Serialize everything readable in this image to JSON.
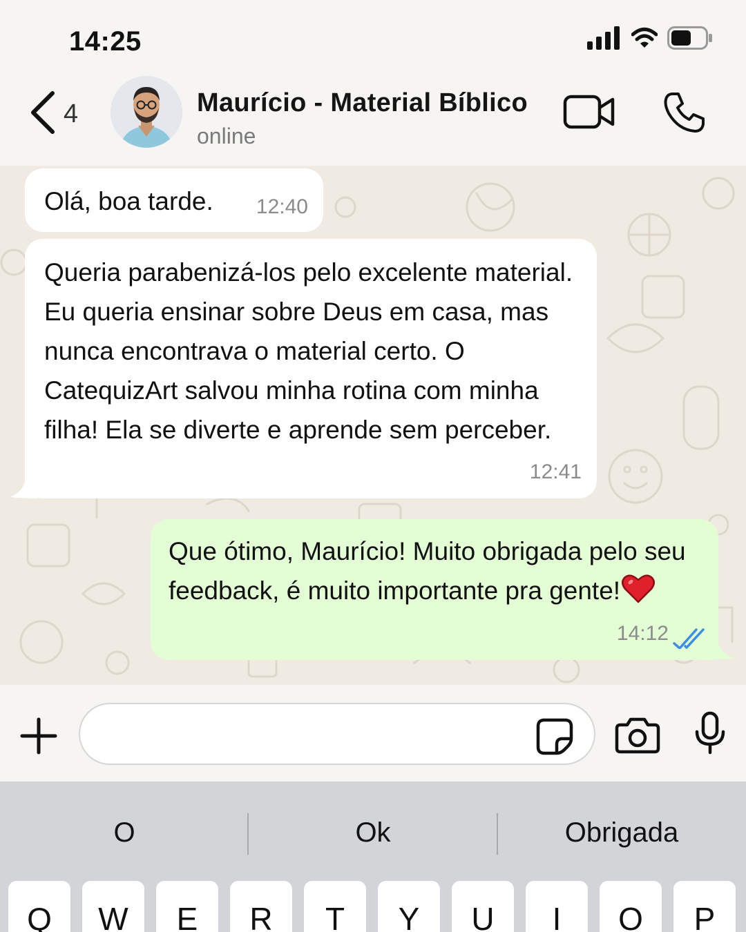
{
  "status_bar": {
    "time": "14:25",
    "icons": [
      "signal-icon",
      "wifi-icon",
      "battery-icon"
    ]
  },
  "header": {
    "back_count": "4",
    "contact_name": "Maurício - Material Bíblico",
    "contact_status": "online",
    "icons": [
      "back-chevron-icon",
      "video-call-icon",
      "phone-icon"
    ]
  },
  "messages": [
    {
      "direction": "incoming",
      "text": "Olá, boa tarde.",
      "time": "12:40"
    },
    {
      "direction": "incoming",
      "text": "Queria parabenizá-los pelo excelente material. Eu queria ensinar sobre Deus em casa, mas nunca encontrava o material certo. O CatequizArt salvou minha rotina com minha filha! Ela se diverte e aprende sem perceber.",
      "time": "12:41"
    },
    {
      "direction": "outgoing",
      "text": "Que ótimo, Maurício! Muito obrigada pelo seu feedback, é muito importante pra gente!",
      "time": "14:12",
      "status": "read"
    }
  ],
  "input_bar": {
    "placeholder": "",
    "icons": [
      "plus-icon",
      "sticker-icon",
      "camera-icon",
      "microphone-icon"
    ]
  },
  "keyboard": {
    "suggestions": [
      "O",
      "Ok",
      "Obrigada"
    ],
    "top_row": [
      "Q",
      "W",
      "E",
      "R",
      "T",
      "Y",
      "U",
      "I",
      "O",
      "P"
    ]
  },
  "colors": {
    "incoming_bubble": "#ffffff",
    "outgoing_bubble": "#e3fdd4",
    "chat_background": "#efeae2",
    "read_receipt": "#3b8fe0",
    "heart": "#e0202a"
  }
}
